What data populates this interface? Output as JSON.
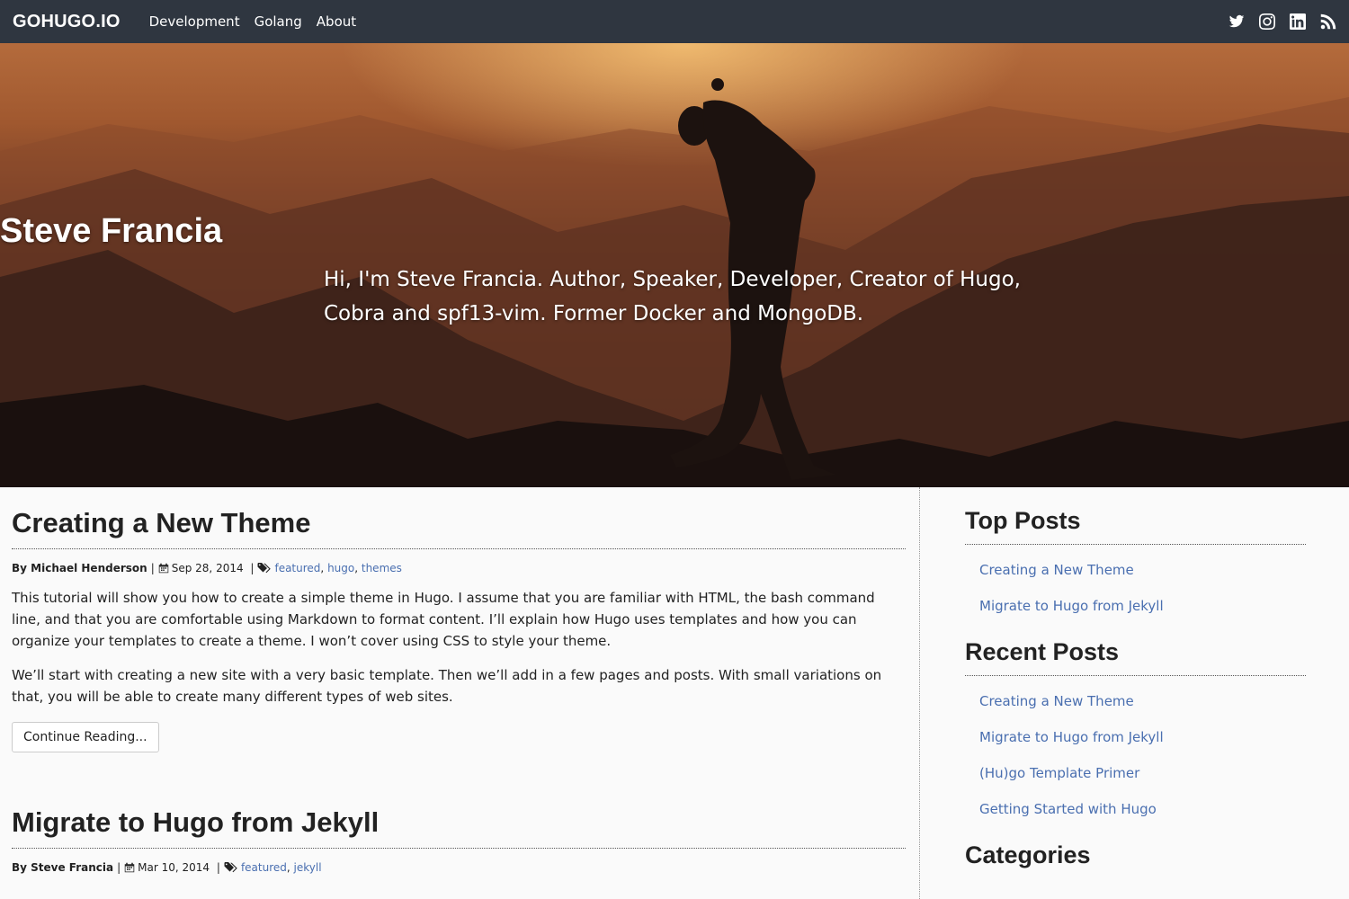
{
  "navbar": {
    "brand": "GOHUGO.IO",
    "links": [
      "Development",
      "Golang",
      "About"
    ],
    "social_icons": [
      "twitter-icon",
      "instagram-icon",
      "linkedin-icon",
      "rss-icon"
    ]
  },
  "hero": {
    "title": "Steve Francia",
    "subtitle": "Hi, I'm Steve Francia. Author, Speaker, Developer, Creator of Hugo, Cobra and spf13-vim. Former Docker and MongoDB."
  },
  "posts": [
    {
      "title": "Creating a New Theme",
      "author": "By Michael Henderson",
      "date": "Sep 28, 2014",
      "tags": [
        "featured",
        "hugo",
        "themes"
      ],
      "paragraphs": [
        "This tutorial will show you how to create a simple theme in Hugo. I assume that you are familiar with HTML, the bash command line, and that you are comfortable using Markdown to format content. I’ll explain how Hugo uses templates and how you can organize your templates to create a theme. I won’t cover using CSS to style your theme.",
        "We’ll start with creating a new site with a very basic template. Then we’ll add in a few pages and posts. With small variations on that, you will be able to create many different types of web sites."
      ],
      "continue_label": "Continue Reading..."
    },
    {
      "title": "Migrate to Hugo from Jekyll",
      "author": "By Steve Francia",
      "date": "Mar 10, 2014",
      "tags": [
        "featured",
        "jekyll"
      ]
    }
  ],
  "sidebar": {
    "top_posts": {
      "heading": "Top Posts",
      "items": [
        "Creating a New Theme",
        "Migrate to Hugo from Jekyll"
      ]
    },
    "recent_posts": {
      "heading": "Recent Posts",
      "items": [
        "Creating a New Theme",
        "Migrate to Hugo from Jekyll",
        "(Hu)go Template Primer",
        "Getting Started with Hugo"
      ]
    },
    "categories": {
      "heading": "Categories"
    }
  },
  "colors": {
    "navbar_bg": "#2f3640",
    "link": "#4a6fb0"
  }
}
